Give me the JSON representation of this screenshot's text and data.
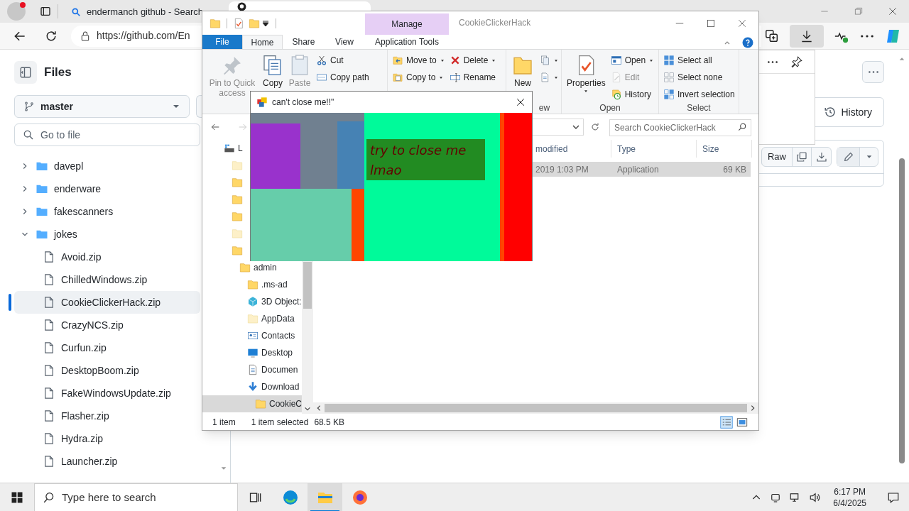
{
  "browser": {
    "tabs": [
      {
        "label": "endermanch github - Search",
        "selected": false
      }
    ],
    "address": "https://github.com/En"
  },
  "github": {
    "sidebar": {
      "title": "Files",
      "branch": "master",
      "search_placeholder": "Go to file",
      "tree": [
        {
          "name": "davepl",
          "kind": "folder",
          "expanded": false,
          "selected": false
        },
        {
          "name": "enderware",
          "kind": "folder",
          "expanded": false,
          "selected": false
        },
        {
          "name": "fakescanners",
          "kind": "folder",
          "expanded": false,
          "selected": false
        },
        {
          "name": "jokes",
          "kind": "folder",
          "expanded": true,
          "selected": false,
          "children": [
            {
              "name": "Avoid.zip",
              "kind": "file",
              "selected": false
            },
            {
              "name": "ChilledWindows.zip",
              "kind": "file",
              "selected": false
            },
            {
              "name": "CookieClickerHack.zip",
              "kind": "file",
              "selected": true
            },
            {
              "name": "CrazyNCS.zip",
              "kind": "file",
              "selected": false
            },
            {
              "name": "Curfun.zip",
              "kind": "file",
              "selected": false
            },
            {
              "name": "DesktopBoom.zip",
              "kind": "file",
              "selected": false
            },
            {
              "name": "FakeWindowsUpdate.zip",
              "kind": "file",
              "selected": false
            },
            {
              "name": "Flasher.zip",
              "kind": "file",
              "selected": false
            },
            {
              "name": "Hydra.zip",
              "kind": "file",
              "selected": false
            },
            {
              "name": "Launcher.zip",
              "kind": "file",
              "selected": false
            }
          ]
        }
      ]
    },
    "file_actions": {
      "history": "History",
      "raw": "Raw"
    }
  },
  "explorer": {
    "title": "CookieClickerHack",
    "context_tab": "Manage",
    "ribbon_tabs": [
      {
        "label": "File",
        "kind": "file",
        "selected": false
      },
      {
        "label": "Home",
        "kind": "tab",
        "selected": true
      },
      {
        "label": "Share",
        "kind": "tab",
        "selected": false
      },
      {
        "label": "View",
        "kind": "tab",
        "selected": false
      },
      {
        "label": "Application Tools",
        "kind": "tab",
        "selected": false
      }
    ],
    "ribbon_groups": [
      {
        "columns": [
          {
            "kind": "large",
            "items": [
              {
                "label": "Pin to Quick access",
                "disabled": true
              },
              {
                "label": "Copy",
                "disabled": false
              },
              {
                "label": "Paste",
                "disabled": true
              }
            ]
          },
          {
            "kind": "small",
            "items": [
              {
                "label": "Cut",
                "disabled": false
              },
              {
                "label": "Copy path",
                "disabled": false
              }
            ]
          }
        ]
      },
      {
        "columns": [
          {
            "kind": "small",
            "items": [
              {
                "label": "Move to",
                "dropdown": true,
                "disabled": false
              },
              {
                "label": "Copy to",
                "dropdown": true,
                "disabled": false
              }
            ]
          },
          {
            "kind": "small",
            "items": [
              {
                "label": "Delete",
                "dropdown": true,
                "disabled": false
              },
              {
                "label": "Rename",
                "disabled": false
              }
            ]
          }
        ]
      },
      {
        "label": "ew",
        "columns": [
          {
            "kind": "large",
            "items": [
              {
                "label": "New",
                "disabled": false
              }
            ]
          },
          {
            "kind": "small",
            "items": [
              {
                "dropdown": true,
                "disabled": false
              },
              {
                "dropdown": true,
                "disabled": false
              }
            ]
          }
        ]
      },
      {
        "label": "Open",
        "columns": [
          {
            "kind": "large",
            "items": [
              {
                "label": "Properties",
                "dropdown": true,
                "disabled": false
              }
            ]
          },
          {
            "kind": "small",
            "items": [
              {
                "label": "Open",
                "dropdown": true,
                "disabled": false
              },
              {
                "label": "Edit",
                "disabled": true
              },
              {
                "label": "History",
                "disabled": false
              }
            ]
          }
        ]
      },
      {
        "label": "Select",
        "columns": [
          {
            "kind": "small",
            "items": [
              {
                "label": "Select all",
                "disabled": false
              },
              {
                "label": "Select none",
                "disabled": false
              },
              {
                "label": "Invert selection",
                "disabled": false
              }
            ]
          }
        ]
      }
    ],
    "search_placeholder": "Search CookieClickerHack",
    "nav": [
      {
        "label": "L",
        "kind": "drive",
        "selected": false,
        "children": [
          {
            "kind": "folder_faded",
            "selected": false
          },
          {
            "kind": "folder",
            "selected": false
          },
          {
            "kind": "folder",
            "selected": false
          },
          {
            "kind": "folder",
            "selected": false
          },
          {
            "kind": "folder_faded",
            "selected": false
          },
          {
            "kind": "folder",
            "selected": false,
            "children": [
              {
                "label": "admin",
                "kind": "folder",
                "selected": false,
                "children": [
                  {
                    "label": ".ms-ad",
                    "kind": "folder",
                    "selected": false
                  },
                  {
                    "label": "3D Object:",
                    "kind": "objects3d",
                    "selected": false
                  },
                  {
                    "label": "AppData",
                    "kind": "folder_faded",
                    "selected": false
                  },
                  {
                    "label": "Contacts",
                    "kind": "contacts",
                    "selected": false
                  },
                  {
                    "label": "Desktop",
                    "kind": "desktop",
                    "selected": false
                  },
                  {
                    "label": "Documen",
                    "kind": "documents",
                    "selected": false
                  },
                  {
                    "label": "Download",
                    "kind": "downloads",
                    "selected": false,
                    "children": [
                      {
                        "label": "CookieC",
                        "kind": "folder",
                        "selected": true
                      }
                    ]
                  }
                ]
              }
            ]
          }
        ]
      }
    ],
    "columns": [
      "modified",
      "Type",
      "Size"
    ],
    "rows": [
      {
        "cells": [
          "2019 1:03 PM",
          "Application",
          "69 KB"
        ],
        "selected": true
      }
    ],
    "status": [
      "1 item",
      "1 item selected",
      "68.5 KB"
    ]
  },
  "popup": {
    "title": "can't close me!!\"",
    "message": "try to close me lmao"
  },
  "taskbar": {
    "search_placeholder": "Type here to search",
    "time": "6:17 PM",
    "date": "6/4/2025"
  }
}
